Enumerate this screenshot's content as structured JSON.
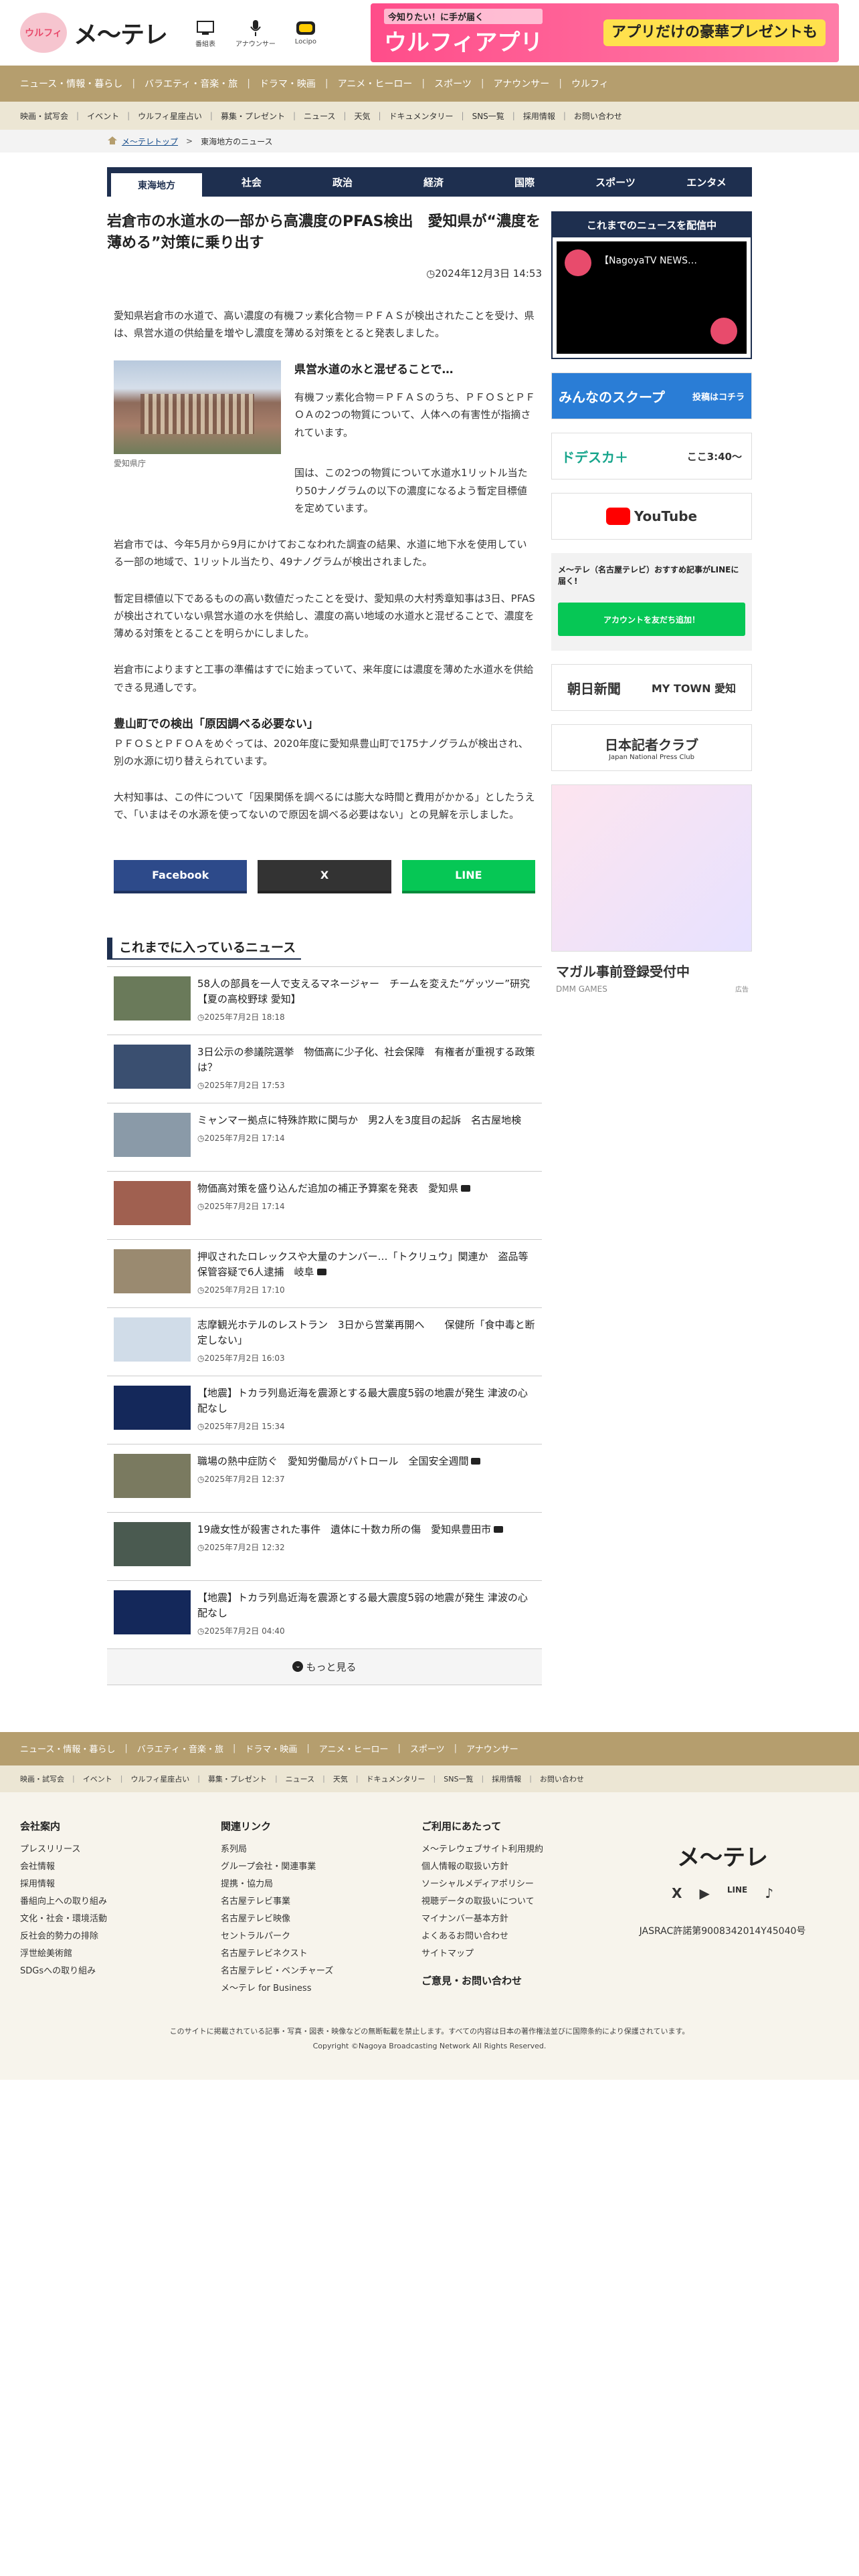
{
  "header": {
    "logo_text": "メ～テレ",
    "mascot_text": "ウルフィ",
    "icons": [
      {
        "name": "tv-icon",
        "label": "番組表"
      },
      {
        "name": "mic-icon",
        "label": "アナウンサー"
      },
      {
        "name": "locipo-icon",
        "label": "Locipo"
      }
    ],
    "banner": {
      "sub": "今知りたい！に手が届く",
      "main": "ウルフィアプリ",
      "right": "アプリだけの豪華プレゼントも"
    }
  },
  "nav_main": [
    "ニュース・情報・暮らし",
    "バラエティ・音楽・旅",
    "ドラマ・映画",
    "アニメ・ヒーロー",
    "スポーツ",
    "アナウンサー",
    "ウルフィ"
  ],
  "nav_sub": [
    "映画・試写会",
    "イベント",
    "ウルフィ星座占い",
    "募集・プレゼント",
    "ニュース",
    "天気",
    "ドキュメンタリー",
    "SNS一覧",
    "採用情報",
    "お問い合わせ"
  ],
  "breadcrumb": {
    "home": "メ～テレトップ",
    "current": "東海地方のニュース"
  },
  "category_tabs": [
    "東海地方",
    "社会",
    "政治",
    "経済",
    "国際",
    "スポーツ",
    "エンタメ"
  ],
  "article": {
    "title": "岩倉市の水道水の一部から高濃度のPFAS検出　愛知県が“濃度を薄める”対策に乗り出す",
    "date": "2024年12月3日 14:53",
    "lead": "愛知県岩倉市の水道で、高い濃度の有機フッ素化合物＝ＰＦＡＳが検出されたことを受け、県は、県営水道の供給量を増やし濃度を薄める対策をとると発表しました。",
    "sub_heading1": "県営水道の水と混ぜることで…",
    "fig_text": "有機フッ素化合物＝ＰＦＡＳのうち、ＰＦＯＳとＰＦＯＡの2つの物質について、人体への有害性が指摘されています。",
    "fig_text2": "国は、この2つの物質について水道水1リットル当たり50ナノグラムの以下の濃度になるよう暫定目標値を定めています。",
    "caption": "愛知県庁",
    "p2": "岩倉市では、今年5月から9月にかけておこなわれた調査の結果、水道に地下水を使用している一部の地域で、1リットル当たり、49ナノグラムが検出されました。",
    "p3": "暫定目標値以下であるものの高い数値だったことを受け、愛知県の大村秀章知事は3日、PFASが検出されていない県営水道の水を供給し、濃度の高い地域の水道水と混ぜることで、濃度を薄める対策をとることを明らかにしました。",
    "p4": "岩倉市によりますと工事の準備はすでに始まっていて、来年度には濃度を薄めた水道水を供給できる見通しです。",
    "sub_heading2": "豊山町での検出「原因調べる必要ない」",
    "p5": "ＰＦＯＳとＰＦＯＡをめぐっては、2020年度に愛知県豊山町で175ナノグラムが検出され、別の水源に切り替えられています。",
    "p6": "大村知事は、この件について「因果関係を調べるには膨大な時間と費用がかかる」としたうえで、「いまはその水源を使ってないので原因を調べる必要はない」との見解を示しました。"
  },
  "share": {
    "facebook": "Facebook",
    "x": "X",
    "line": "LINE"
  },
  "news_section_title": "これまでに入っているニュース",
  "news": [
    {
      "title": "58人の部員を一人で支えるマネージャー　チームを変えた“ゲッツー”研究【夏の高校野球 愛知】",
      "date": "2025年7月2日 18:18",
      "video": false,
      "color": "#6a7a5a"
    },
    {
      "title": "3日公示の参議院選挙　物価高に少子化、社会保障　有権者が重視する政策は？",
      "date": "2025年7月2日 17:53",
      "video": false,
      "color": "#3a4f70"
    },
    {
      "title": "ミャンマー拠点に特殊詐欺に関与か　男2人を3度目の起訴　名古屋地検",
      "date": "2025年7月2日 17:14",
      "video": false,
      "color": "#8a9aa8"
    },
    {
      "title": "物価高対策を盛り込んだ追加の補正予算案を発表　愛知県",
      "date": "2025年7月2日 17:14",
      "video": true,
      "color": "#a06050"
    },
    {
      "title": "押収されたロレックスや大量のナンバー…「トクリュウ」関連か　盗品等保管容疑で6人逮捕　岐阜",
      "date": "2025年7月2日 17:10",
      "video": true,
      "color": "#9a8a70"
    },
    {
      "title": "志摩観光ホテルのレストラン　3日から営業再開へ　　保健所「食中毒と断定しない」",
      "date": "2025年7月2日 16:03",
      "video": false,
      "color": "#d0dce8"
    },
    {
      "title": "【地震】トカラ列島近海を震源とする最大震度5弱の地震が発生 津波の心配なし",
      "date": "2025年7月2日 15:34",
      "video": false,
      "color": "#14285a"
    },
    {
      "title": "職場の熱中症防ぐ　愛知労働局がパトロール　全国安全週間",
      "date": "2025年7月2日 12:37",
      "video": true,
      "color": "#7a7a60"
    },
    {
      "title": "19歳女性が殺害された事件　遺体に十数カ所の傷　愛知県豊田市",
      "date": "2025年7月2日 12:32",
      "video": true,
      "color": "#4a5a50"
    },
    {
      "title": "【地震】トカラ列島近海を震源とする最大震度5弱の地震が発生 津波の心配なし",
      "date": "2025年7月2日 04:40",
      "video": false,
      "color": "#14285a"
    }
  ],
  "more_label": "もっと見る",
  "sidebar": {
    "live_title": "これまでのニュースを配信中",
    "video_title": "【NagoyaTV NEWS…",
    "scoop": "みんなのスクープ",
    "scoop_side": "投稿はコチラ",
    "doraka": "ドデスカ＋",
    "doraka_time": "ここ3:40～",
    "youtube": "YouTube",
    "line_text": "メ～テレ（名古屋テレビ）おすすめ記事がLINEに届く!",
    "line_btn": "アカウントを友だち追加！",
    "asahi": "朝日新聞",
    "mytown": "MY TOWN 愛知",
    "press": "日本記者クラブ",
    "press_en": "Japan National Press Club",
    "ad_title": "マガル事前登録受付中",
    "ad_sub": "DMM GAMES",
    "ad_tag": "広告"
  },
  "footer": {
    "cols": [
      {
        "title": "会社案内",
        "items": [
          "プレスリリース",
          "会社情報",
          "採用情報",
          "番組向上への取り組み",
          "文化・社会・環境活動",
          "反社会的勢力の排除",
          "浮世絵美術館",
          "SDGsへの取り組み"
        ]
      },
      {
        "title": "関連リンク",
        "items": [
          "系列局",
          "グループ会社・関連事業",
          "提携・協力局",
          "名古屋テレビ事業",
          "名古屋テレビ映像",
          "セントラルパーク",
          "名古屋テレビネクスト",
          "名古屋テレビ・ベンチャーズ",
          "メ～テレ for Business"
        ]
      },
      {
        "title": "ご利用にあたって",
        "items": [
          "メ～テレウェブサイト利用規約",
          "個人情報の取扱い方針",
          "ソーシャルメディアポリシー",
          "視聴データの取扱いについて",
          "マイナンバー基本方針",
          "よくあるお問い合わせ",
          "サイトマップ"
        ]
      }
    ],
    "contact": "ご意見・お問い合わせ",
    "brand": "メ～テレ",
    "social": [
      "X",
      "▶",
      "LINE",
      "♪"
    ],
    "jasrac": "JASRAC許諾第9008342014Y45040号",
    "notice": "このサイトに掲載されている記事・写真・図表・映像などの無断転載を禁止します。すべての内容は日本の著作権法並びに国際条約により保護されています。",
    "copyright": "Copyright ©Nagoya Broadcasting Network All Rights Reserved."
  }
}
